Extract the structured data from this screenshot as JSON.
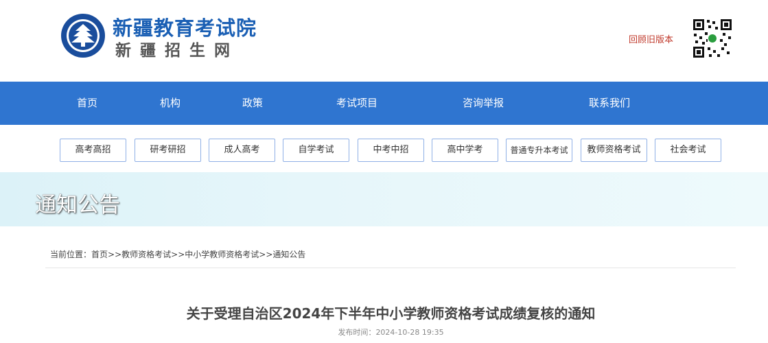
{
  "header": {
    "site_name": "新疆教育考试院",
    "site_sub": "新疆招生网",
    "old_version": "回顾旧版本"
  },
  "nav": [
    {
      "label": "首页"
    },
    {
      "label": "机构"
    },
    {
      "label": "政策"
    },
    {
      "label": "考试项目"
    },
    {
      "label": "咨询举报"
    },
    {
      "label": "联系我们"
    }
  ],
  "subnav": [
    {
      "label": "高考高招"
    },
    {
      "label": "研考研招"
    },
    {
      "label": "成人高考"
    },
    {
      "label": "自学考试"
    },
    {
      "label": "中考中招"
    },
    {
      "label": "高中学考"
    },
    {
      "label": "普通专升本考试"
    },
    {
      "label": "教师资格考试"
    },
    {
      "label": "社会考试"
    }
  ],
  "banner": {
    "title": "通知公告"
  },
  "breadcrumb": {
    "prefix": "当前位置：",
    "items": [
      "首页",
      "教师资格考试",
      "中小学教师资格考试",
      "通知公告"
    ],
    "separator": ">>"
  },
  "article": {
    "title": "关于受理自治区2024年下半年中小学教师资格考试成绩复核的通知",
    "publish_label": "发布时间：",
    "publish_time": "2024-10-28 19:35"
  },
  "colors": {
    "nav_bg": "#2f75d0",
    "brand": "#1a5fb4",
    "old_version": "#c0392b"
  }
}
